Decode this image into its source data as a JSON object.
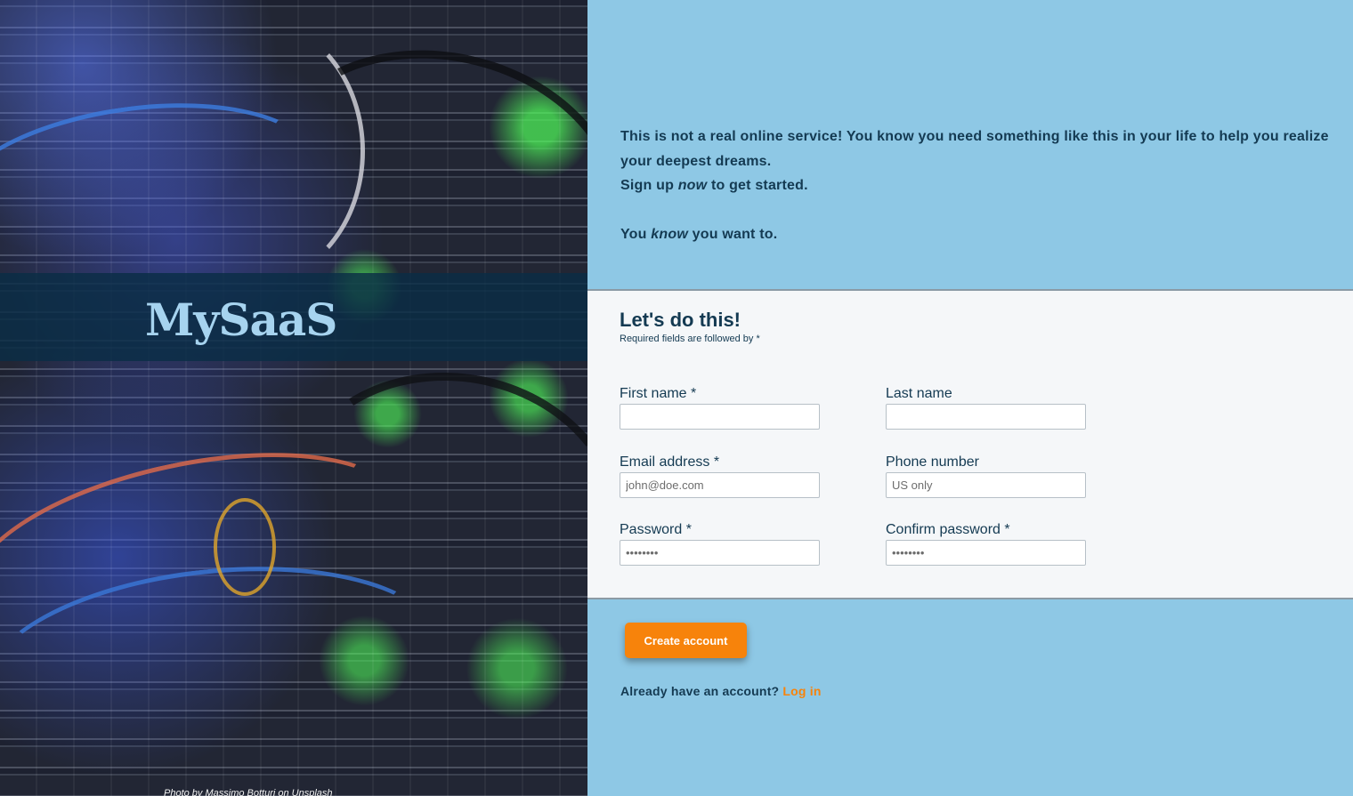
{
  "hero": {
    "brand": "MySaaS",
    "photo_credit": "Photo by Massimo Botturi on Unsplash"
  },
  "intro": {
    "line1": "This is not a real online service! You know you need something like this in your life to help you realize your deepest dreams.",
    "line2_pre": "Sign up ",
    "line2_em": "now",
    "line2_post": " to get started.",
    "line3_pre": "You ",
    "line3_em": "know",
    "line3_post": " you want to."
  },
  "form": {
    "title": "Let's do this!",
    "subtitle": "Required fields are followed by *",
    "fields": {
      "first_name": {
        "label": "First name *",
        "value": "",
        "placeholder": ""
      },
      "last_name": {
        "label": "Last name",
        "value": "",
        "placeholder": ""
      },
      "email": {
        "label": "Email address *",
        "value": "",
        "placeholder": "john@doe.com"
      },
      "phone": {
        "label": "Phone number",
        "value": "",
        "placeholder": "US only"
      },
      "password": {
        "label": "Password *",
        "value": "",
        "placeholder": "••••••••"
      },
      "confirm_password": {
        "label": "Confirm password *",
        "value": "",
        "placeholder": "••••••••"
      }
    }
  },
  "actions": {
    "create_account": "Create account",
    "login_prompt": "Already have an account?",
    "login_link": "Log in"
  },
  "colors": {
    "background": "#8ec8e5",
    "accent": "#f7830b",
    "text": "#143a52",
    "card": "#f5f7f9"
  }
}
